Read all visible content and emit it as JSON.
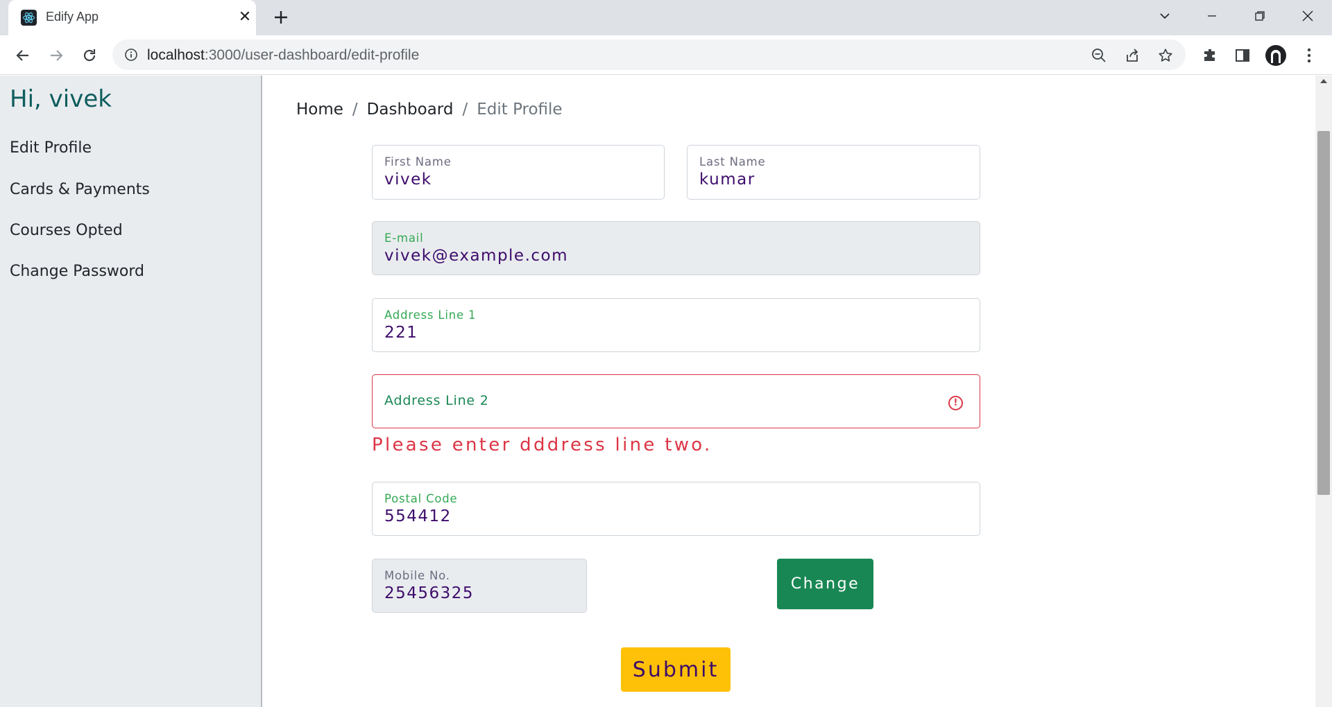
{
  "browser": {
    "tab_title": "Edify App",
    "url_host": "localhost",
    "url_path": ":3000/user-dashboard/edit-profile"
  },
  "sidebar": {
    "greeting": "Hi, vivek",
    "items": [
      {
        "label": "Edit Profile"
      },
      {
        "label": "Cards & Payments"
      },
      {
        "label": "Courses Opted"
      },
      {
        "label": "Change Password"
      }
    ]
  },
  "breadcrumb": {
    "items": [
      "Home",
      "Dashboard",
      "Edit Profile"
    ],
    "separator": "/"
  },
  "form": {
    "first_name": {
      "label": "First Name",
      "value": "vivek"
    },
    "last_name": {
      "label": "Last Name",
      "value": "kumar"
    },
    "email": {
      "label": "E-mail",
      "value": "vivek@example.com"
    },
    "address1": {
      "label": "Address Line 1",
      "value": "221"
    },
    "address2": {
      "label": "Address Line 2",
      "value": "",
      "error": "Please enter dddress line two."
    },
    "postal": {
      "label": "Postal Code",
      "value": "554412"
    },
    "mobile": {
      "label": "Mobile No.",
      "value": "25456325"
    },
    "change_label": "Change",
    "submit_label": "Submit"
  },
  "colors": {
    "primary_text": "#3d0c6b",
    "success": "#198754",
    "warning": "#ffc107",
    "danger": "#dc3545",
    "greeting": "#0f5d5e"
  },
  "icons": {
    "favicon": "react-logo-icon",
    "error": "exclamation-circle-icon"
  }
}
